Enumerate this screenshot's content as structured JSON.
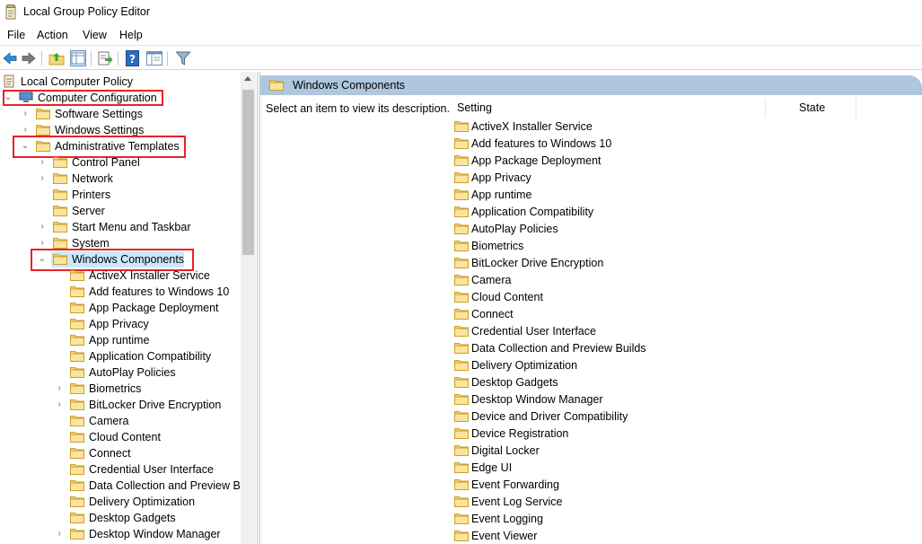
{
  "window": {
    "title": "Local Group Policy Editor"
  },
  "menu": {
    "file": "File",
    "action": "Action",
    "view": "View",
    "help": "Help"
  },
  "toolbar": {
    "buttons": [
      "back-icon",
      "forward-icon",
      "up-folder-icon",
      "show-hide-tree-icon",
      "export-list-icon",
      "help-icon",
      "extended-view-icon",
      "filter-icon"
    ]
  },
  "tree": {
    "root": "Local Computer Policy",
    "computer_configuration": "Computer Configuration",
    "software_settings": "Software Settings",
    "windows_settings": "Windows Settings",
    "administrative_templates": "Administrative Templates",
    "control_panel": "Control Panel",
    "network": "Network",
    "printers": "Printers",
    "server": "Server",
    "start_menu": "Start Menu and Taskbar",
    "system": "System",
    "windows_components": "Windows Components",
    "children": [
      "ActiveX Installer Service",
      "Add features to Windows 10",
      "App Package Deployment",
      "App Privacy",
      "App runtime",
      "Application Compatibility",
      "AutoPlay Policies",
      "Biometrics",
      "BitLocker Drive Encryption",
      "Camera",
      "Cloud Content",
      "Connect",
      "Credential User Interface",
      "Data Collection and Preview Bui",
      "Delivery Optimization",
      "Desktop Gadgets",
      "Desktop Window Manager"
    ]
  },
  "right": {
    "header": "Windows Components",
    "description": "Select an item to view its description.",
    "columns": {
      "setting": "Setting",
      "state": "State"
    },
    "items": [
      "ActiveX Installer Service",
      "Add features to Windows 10",
      "App Package Deployment",
      "App Privacy",
      "App runtime",
      "Application Compatibility",
      "AutoPlay Policies",
      "Biometrics",
      "BitLocker Drive Encryption",
      "Camera",
      "Cloud Content",
      "Connect",
      "Credential User Interface",
      "Data Collection and Preview Builds",
      "Delivery Optimization",
      "Desktop Gadgets",
      "Desktop Window Manager",
      "Device and Driver Compatibility",
      "Device Registration",
      "Digital Locker",
      "Edge UI",
      "Event Forwarding",
      "Event Log Service",
      "Event Logging",
      "Event Viewer"
    ]
  },
  "colors": {
    "highlight_box": "#e8212b",
    "selection": "#cce8ff",
    "header_band": "#afc7de",
    "folder": "#e8c55a"
  }
}
